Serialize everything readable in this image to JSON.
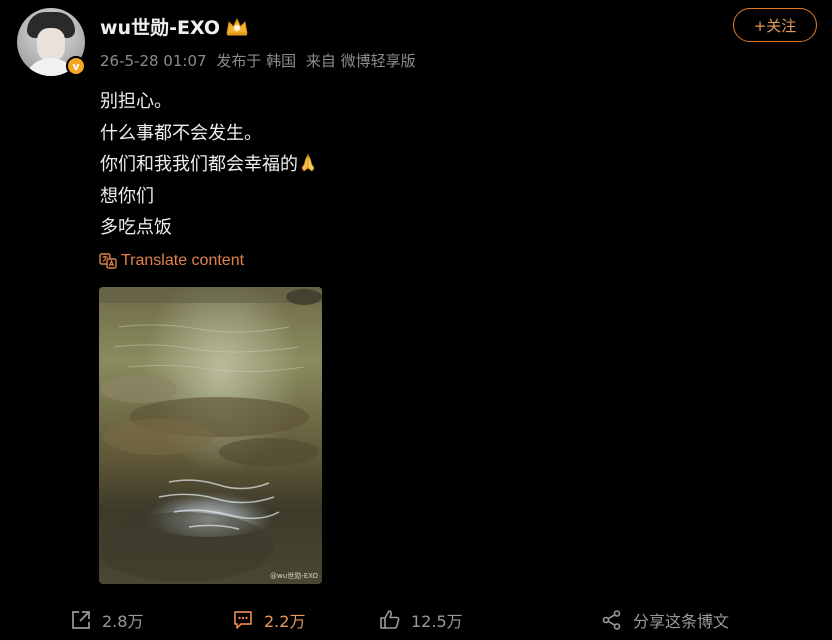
{
  "post": {
    "username": "wu世勋-EXO",
    "meta": {
      "date": "26-5-28 01:07",
      "published": "发布于 韩国",
      "source": "来自 微博轻享版"
    },
    "follow_label": "+关注",
    "lines": [
      "别担心。",
      "什么事都不会发生。",
      "你们和我我们都会幸福的",
      "想你们",
      "多吃点饭"
    ],
    "translate_label": "Translate content",
    "photo_watermark": "@wu世勋-EXO"
  },
  "actions": {
    "repost_count": "2.8万",
    "comment_count": "2.2万",
    "like_count": "12.5万",
    "share_label": "分享这条博文"
  },
  "icons": {
    "avatar": "avatar",
    "verified": "verified-badge-icon",
    "crown": "crown-icon",
    "pray": "folded-hands-emoji",
    "translate": "translate-icon",
    "repost": "repost-icon",
    "comment": "comment-icon",
    "like": "thumbs-up-icon",
    "share": "share-icon"
  },
  "colors": {
    "accent": "#e0834a",
    "verified": "#f5a623",
    "background": "#000000",
    "muted_text": "#8c8c8c"
  }
}
